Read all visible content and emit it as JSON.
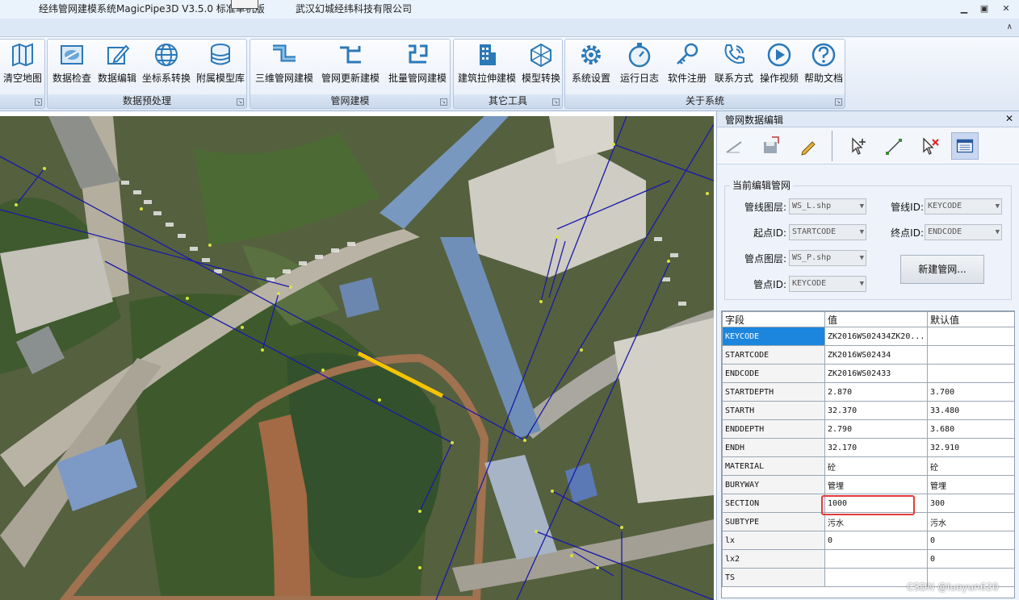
{
  "titlebar": {
    "title": "经纬管网建模系统MagicPipe3D  V3.5.0  标准单机版",
    "company": "武汉幻城经纬科技有限公司",
    "minimize": "▁",
    "restore": "▣",
    "close": "✕"
  },
  "tabstrip": {
    "collapse": "∧"
  },
  "ribbon": {
    "group_map": {
      "label": "",
      "buttons": [
        "清空地图"
      ]
    },
    "group_preprocess": {
      "label": "数据预处理",
      "buttons": [
        "数据检查",
        "数据编辑",
        "坐标系转换",
        "附属模型库"
      ]
    },
    "group_modeling": {
      "label": "管网建模",
      "buttons": [
        "三维管网建模",
        "管网更新建模",
        "批量管网建模"
      ]
    },
    "group_other": {
      "label": "其它工具",
      "buttons": [
        "建筑拉伸建模",
        "模型转换"
      ]
    },
    "group_about": {
      "label": "关于系统",
      "buttons": [
        "系统设置",
        "运行日志",
        "软件注册",
        "联系方式",
        "操作视频",
        "帮助文档"
      ]
    }
  },
  "panel": {
    "title": "管网数据编辑",
    "close": "✕",
    "toolbar_icons": [
      "draw-line-icon",
      "save-icon",
      "pencil-icon",
      "select-node-icon",
      "line-tool-icon",
      "delete-select-icon",
      "attribute-table-icon"
    ],
    "current": {
      "legend": "当前编辑管网",
      "line_layer_label": "管线图层:",
      "line_layer_value": "WS_L.shp",
      "line_id_label": "管线ID:",
      "line_id_value": "KEYCODE",
      "start_id_label": "起点ID:",
      "start_id_value": "STARTCODE",
      "end_id_label": "终点ID:",
      "end_id_value": "ENDCODE",
      "point_layer_label": "管点图层:",
      "point_layer_value": "WS_P.shp",
      "point_id_label": "管点ID:",
      "point_id_value": "KEYCODE",
      "new_button": "新建管网..."
    },
    "grid": {
      "headers": [
        "字段",
        "值",
        "默认值"
      ],
      "rows": [
        [
          "KEYCODE",
          "ZK2016WS02434ZK20...",
          ""
        ],
        [
          "STARTCODE",
          "ZK2016WS02434",
          ""
        ],
        [
          "ENDCODE",
          "ZK2016WS02433",
          ""
        ],
        [
          "STARTDEPTH",
          "2.870",
          "3.700"
        ],
        [
          "STARTH",
          "32.370",
          "33.480"
        ],
        [
          "ENDDEPTH",
          "2.790",
          "3.680"
        ],
        [
          "ENDH",
          "32.170",
          "32.910"
        ],
        [
          "MATERIAL",
          "砼",
          "砼"
        ],
        [
          "BURYWAY",
          "管埋",
          "管埋"
        ],
        [
          "SECTION",
          "1000",
          "300"
        ],
        [
          "SUBTYPE",
          "污水",
          "污水"
        ],
        [
          "lx",
          "0",
          "0"
        ],
        [
          "lx2",
          "",
          "0"
        ],
        [
          "TS",
          "",
          ""
        ]
      ]
    }
  },
  "watermark": "CSDN @luoyun620",
  "colors": {
    "pipe_line": "#1a1aa8",
    "selected_pipe": "#f5c400",
    "highlight_box": "#e23b3b",
    "selected_cell": "#1c86de"
  }
}
